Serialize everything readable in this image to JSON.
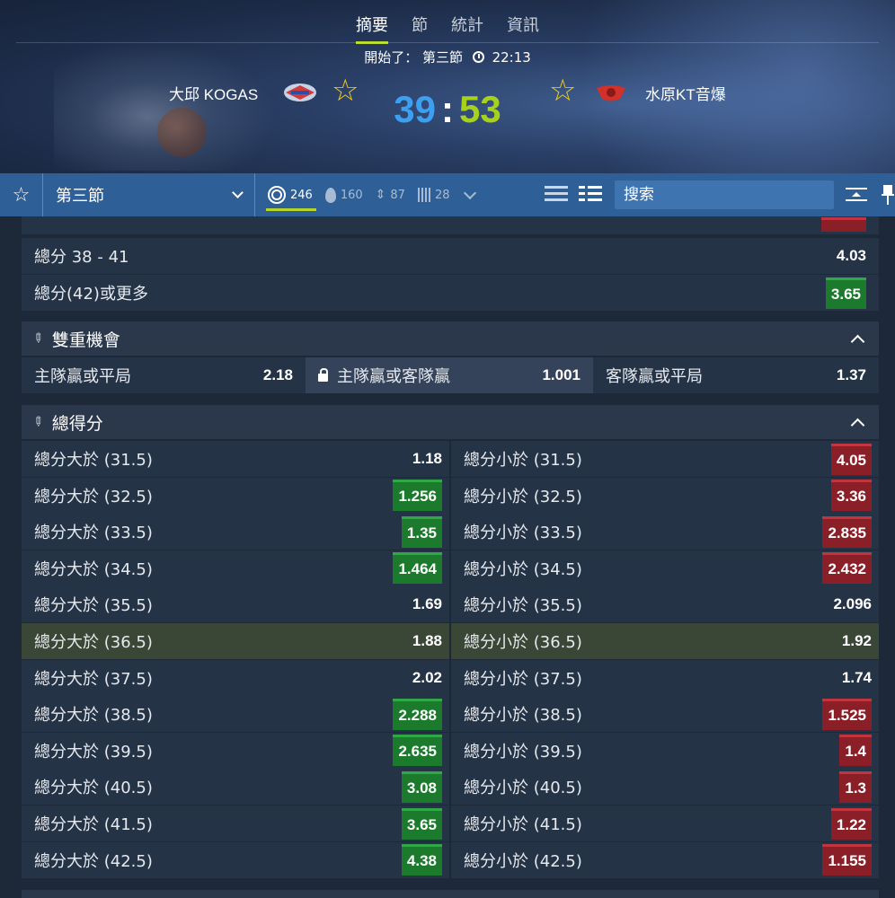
{
  "header": {
    "tabs": [
      "摘要",
      "節",
      "統計",
      "資訊"
    ],
    "status_prefix": "開始了：",
    "period": "第三節",
    "clock": "22:13",
    "home_team": "大邱 KOGAS",
    "away_team": "水原KT音爆",
    "home_score": "39",
    "away_score": "53",
    "score_sep": ":",
    "colors": {
      "home_score": "#3d9ff0",
      "away_score": "#a6d21e",
      "star": "#f2cb1d",
      "active_tab": "#b6d629"
    }
  },
  "toolbar": {
    "period_select": "第三節",
    "filters": [
      {
        "icon": "target-icon",
        "count": "246"
      },
      {
        "icon": "fire-icon",
        "count": "160"
      },
      {
        "icon": "updown-icon",
        "count": "87"
      },
      {
        "icon": "bars-icon",
        "count": "28"
      }
    ],
    "search_placeholder": "搜索"
  },
  "totals_top": [
    {
      "label": "總分 38 - 41",
      "odd": "4.03",
      "style": "plain"
    },
    {
      "label": "總分(42)或更多",
      "odd": "3.65",
      "style": "green"
    }
  ],
  "double_chance": {
    "title": "雙重機會",
    "cells": [
      {
        "label": "主隊贏或平局",
        "odd": "2.18"
      },
      {
        "label": "主隊贏或客隊贏",
        "odd": "1.001",
        "locked": true
      },
      {
        "label": "客隊贏或平局",
        "odd": "1.37"
      }
    ]
  },
  "total_points": {
    "title": "總得分",
    "rows": [
      {
        "over": "總分大於 (31.5)",
        "over_odd": "1.18",
        "over_style": "plain",
        "under": "總分小於 (31.5)",
        "under_odd": "4.05",
        "under_style": "red"
      },
      {
        "over": "總分大於 (32.5)",
        "over_odd": "1.256",
        "over_style": "green",
        "under": "總分小於 (32.5)",
        "under_odd": "3.36",
        "under_style": "red"
      },
      {
        "over": "總分大於 (33.5)",
        "over_odd": "1.35",
        "over_style": "green",
        "under": "總分小於 (33.5)",
        "under_odd": "2.835",
        "under_style": "red"
      },
      {
        "over": "總分大於 (34.5)",
        "over_odd": "1.464",
        "over_style": "green",
        "under": "總分小於 (34.5)",
        "under_odd": "2.432",
        "under_style": "red"
      },
      {
        "over": "總分大於 (35.5)",
        "over_odd": "1.69",
        "over_style": "plain",
        "under": "總分小於 (35.5)",
        "under_odd": "2.096",
        "under_style": "plain"
      },
      {
        "over": "總分大於 (36.5)",
        "over_odd": "1.88",
        "over_style": "plain",
        "under": "總分小於 (36.5)",
        "under_odd": "1.92",
        "under_style": "plain",
        "highlight": true
      },
      {
        "over": "總分大於 (37.5)",
        "over_odd": "2.02",
        "over_style": "plain",
        "under": "總分小於 (37.5)",
        "under_odd": "1.74",
        "under_style": "plain"
      },
      {
        "over": "總分大於 (38.5)",
        "over_odd": "2.288",
        "over_style": "green",
        "under": "總分小於 (38.5)",
        "under_odd": "1.525",
        "under_style": "red"
      },
      {
        "over": "總分大於 (39.5)",
        "over_odd": "2.635",
        "over_style": "green",
        "under": "總分小於 (39.5)",
        "under_odd": "1.4",
        "under_style": "red"
      },
      {
        "over": "總分大於 (40.5)",
        "over_odd": "3.08",
        "over_style": "green",
        "under": "總分小於 (40.5)",
        "under_odd": "1.3",
        "under_style": "red"
      },
      {
        "over": "總分大於 (41.5)",
        "over_odd": "3.65",
        "over_style": "green",
        "under": "總分小於 (41.5)",
        "under_odd": "1.22",
        "under_style": "red"
      },
      {
        "over": "總分大於 (42.5)",
        "over_odd": "4.38",
        "over_style": "green",
        "under": "總分小於 (42.5)",
        "under_odd": "1.155",
        "under_style": "red"
      }
    ]
  }
}
